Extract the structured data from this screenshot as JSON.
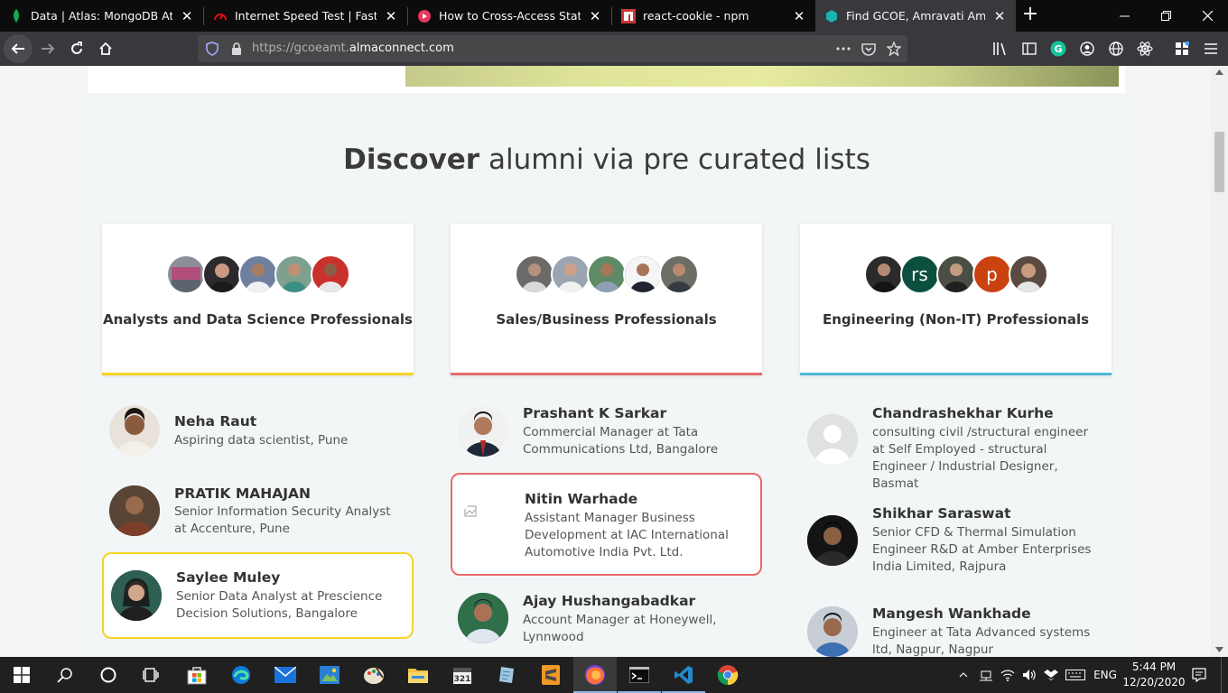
{
  "browser": {
    "tabs": [
      {
        "title": "Data | Atlas: MongoDB Atlas",
        "icon": "leaf-icon",
        "color": "#13aa52"
      },
      {
        "title": "Internet Speed Test | Fast.com",
        "icon": "speedometer-icon",
        "color": "#e50914"
      },
      {
        "title": "How to Cross-Access State Valu",
        "icon": "play-icon",
        "color": "#e8385b"
      },
      {
        "title": "react-cookie - npm",
        "icon": "npm-icon",
        "color": "#cb3837"
      },
      {
        "title": "Find GCOE, Amravati Amravati",
        "icon": "hexagon-icon",
        "color": "#1ab3b3"
      }
    ],
    "url_prefix": "https://gcoeamt.",
    "url_host": "almaconnect.com"
  },
  "page": {
    "heading_bold": "Discover",
    "heading_rest": " alumni via pre curated lists",
    "lists": [
      {
        "title": "Analysts and Data Science Professionals",
        "accent": "#f5d327",
        "avatars": [
          {
            "initial": "",
            "color": "#8a8f99"
          },
          {
            "initial": "",
            "color": "#2c2a2e"
          },
          {
            "initial": "",
            "color": "#6f7f9e"
          },
          {
            "initial": "",
            "color": "#7fa08f"
          },
          {
            "initial": "",
            "color": "#c9312d"
          }
        ],
        "people": [
          {
            "name": "Neha Raut",
            "desc": "Aspiring data scientist, Pune"
          },
          {
            "name": "PRATIK MAHAJAN",
            "desc": "Senior Information Security Analyst at Accenture, Pune"
          },
          {
            "name": "Saylee Muley",
            "desc": "Senior Data Analyst at Prescience Decision Solutions, Bangalore"
          }
        ]
      },
      {
        "title": "Sales/Business Professionals",
        "accent": "#e66a6a",
        "avatars": [
          {
            "initial": "",
            "color": "#6b6a68"
          },
          {
            "initial": "",
            "color": "#9aa5b1"
          },
          {
            "initial": "",
            "color": "#5e8a66"
          },
          {
            "initial": "",
            "color": "#2e3440"
          },
          {
            "initial": "",
            "color": "#6c6e66"
          }
        ],
        "people": [
          {
            "name": "Prashant K Sarkar",
            "desc": "Commercial Manager at Tata Communications Ltd, Bangalore"
          },
          {
            "name": "Nitin Warhade",
            "desc": "Assistant Manager Business Development at IAC International Automotive India Pvt. Ltd."
          },
          {
            "name": "Ajay Hushangabadkar",
            "desc": "Account Manager at Honeywell, Lynnwood"
          }
        ]
      },
      {
        "title": "Engineering (Non-IT) Professionals",
        "accent": "#4fb9d6",
        "avatars": [
          {
            "initial": "",
            "color": "#2b2b2b"
          },
          {
            "initial": "rs",
            "color": "#0d4f3f"
          },
          {
            "initial": "",
            "color": "#4a4f45"
          },
          {
            "initial": "p",
            "color": "#c9420f"
          },
          {
            "initial": "",
            "color": "#5a4a40"
          }
        ],
        "people": [
          {
            "name": "Chandrashekhar Kurhe",
            "desc": "consulting civil /structural engineer at Self Employed - structural Engineer / Industrial Designer, Basmat"
          },
          {
            "name": "Shikhar Saraswat",
            "desc": "Senior CFD & Thermal Simulation Engineer R&D at Amber Enterprises India Limited, Rajpura"
          },
          {
            "name": "Mangesh Wankhade",
            "desc": "Engineer at Tata Advanced systems ltd, Nagpur, Nagpur"
          }
        ]
      }
    ]
  },
  "taskbar": {
    "lang": "ENG",
    "time": "5:44 PM",
    "date": "12/20/2020"
  }
}
